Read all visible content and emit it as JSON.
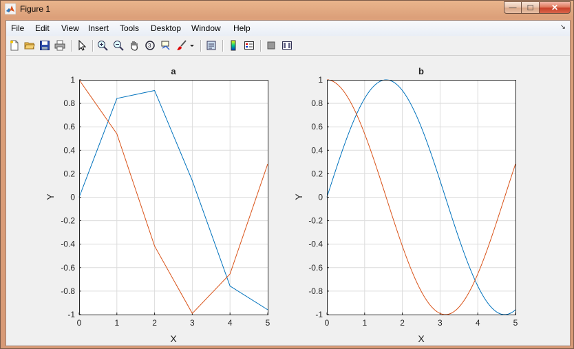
{
  "window": {
    "title": "Figure 1",
    "minimize": "—",
    "maximize": "☐",
    "close": "✕"
  },
  "menubar": {
    "items": [
      "File",
      "Edit",
      "View",
      "Insert",
      "Tools",
      "Desktop",
      "Window",
      "Help"
    ],
    "dock_arrow": "↘"
  },
  "toolbar": {
    "icons": [
      "new-figure-icon",
      "open-file-icon",
      "save-icon",
      "print-icon",
      "pointer-icon",
      "zoom-in-icon",
      "zoom-out-icon",
      "pan-hand-icon",
      "rotate-3d-icon",
      "data-cursor-icon",
      "brush-icon",
      "brush-dropdown-icon",
      "link-plot-icon",
      "colorbar-icon",
      "legend-icon",
      "hide-plot-tools-icon",
      "show-plot-tools-icon"
    ]
  },
  "colors": {
    "series1": "#0072bd",
    "series2": "#d95319"
  },
  "chart_data": [
    {
      "type": "line",
      "title": "a",
      "xlabel": "X",
      "ylabel": "Y",
      "xlim": [
        0,
        5
      ],
      "ylim": [
        -1,
        1
      ],
      "xticks": [
        "0",
        "1",
        "2",
        "3",
        "4",
        "5"
      ],
      "yticks": [
        "1",
        "0.8",
        "0.6",
        "0.4",
        "0.2",
        "0",
        "-0.2",
        "-0.4",
        "-0.6",
        "-0.8",
        "-1"
      ],
      "grid": true,
      "series": [
        {
          "x": [
            0,
            1,
            2,
            3,
            4,
            5
          ],
          "y": [
            0,
            0.8415,
            0.9093,
            0.1411,
            -0.7568,
            -0.9589
          ]
        },
        {
          "x": [
            0,
            1,
            2,
            3,
            4,
            5
          ],
          "y": [
            1,
            0.5403,
            -0.4161,
            -0.99,
            -0.6536,
            0.2837
          ]
        }
      ]
    },
    {
      "type": "line",
      "title": "b",
      "xlabel": "X",
      "ylabel": "Y",
      "xlim": [
        0,
        5
      ],
      "ylim": [
        -1,
        1
      ],
      "xticks": [
        "0",
        "1",
        "2",
        "3",
        "4",
        "5"
      ],
      "yticks": [
        "1",
        "0.8",
        "0.6",
        "0.4",
        "0.2",
        "0",
        "-0.2",
        "-0.4",
        "-0.6",
        "-0.8",
        "-1"
      ],
      "grid": true,
      "series": [
        {
          "function": "sin",
          "x_range": [
            0,
            5
          ]
        },
        {
          "function": "cos",
          "x_range": [
            0,
            5
          ]
        }
      ]
    }
  ]
}
